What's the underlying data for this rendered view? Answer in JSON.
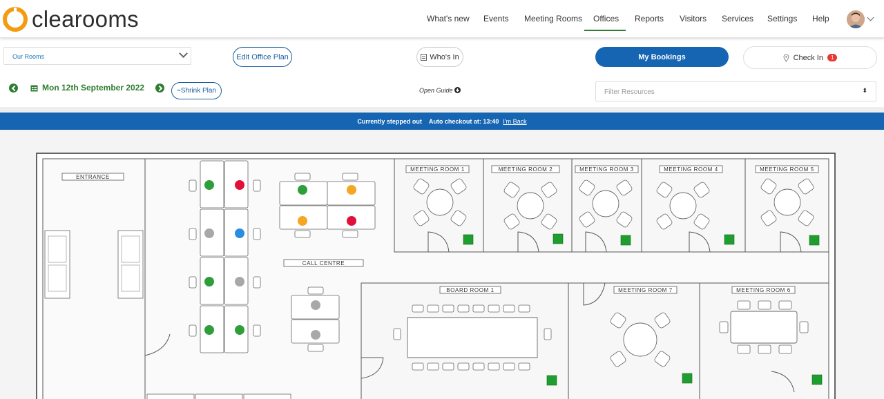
{
  "app": {
    "brand": "clearooms"
  },
  "nav": {
    "items": [
      "What's new",
      "Events",
      "Meeting Rooms",
      "Offices",
      "Reports",
      "Visitors",
      "Services",
      "Settings",
      "Help"
    ],
    "active": "Offices"
  },
  "toolbar": {
    "rooms_select": "Our Rooms",
    "edit_plan": "Edit Office Plan",
    "whos_in": "Who's In",
    "my_bookings": "My Bookings",
    "check_in": "Check In",
    "check_in_count": "1",
    "date": "Mon 12th September 2022",
    "shrink_plan": "Shrink Plan",
    "open_guide": "Open Guide",
    "filter_placeholder": "Filter Resources"
  },
  "banner": {
    "status": "Currently stepped out",
    "auto_checkout": "Auto checkout at: 13:40",
    "back_link": "I'm Back"
  },
  "plan": {
    "labels": {
      "entrance": "ENTRANCE",
      "call_centre": "CALL CENTRE",
      "mr1": "MEETING ROOM 1",
      "mr2": "MEETING ROOM 2",
      "mr3": "MEETING ROOM 3",
      "mr4": "MEETING ROOM 4",
      "mr5": "MEETING ROOM 5",
      "br1": "BOARD ROOM 1",
      "mr7": "MEETING ROOM 7",
      "mr6": "MEETING ROOM 6"
    },
    "colors": {
      "available": "#2e9e3a",
      "booked": "#e0103a",
      "pending": "#f5a623",
      "you": "#2a8de0",
      "unavailable": "#a8a8a8",
      "room_available": "#1f9d2f"
    },
    "desk_status": {
      "pod_a": [
        "available",
        "booked",
        "unavailable",
        "you",
        "available",
        "unavailable",
        "available",
        "available"
      ],
      "cluster_b": [
        "available",
        "pending",
        "pending",
        "booked"
      ],
      "pair_c": [
        "unavailable",
        "unavailable"
      ]
    }
  }
}
